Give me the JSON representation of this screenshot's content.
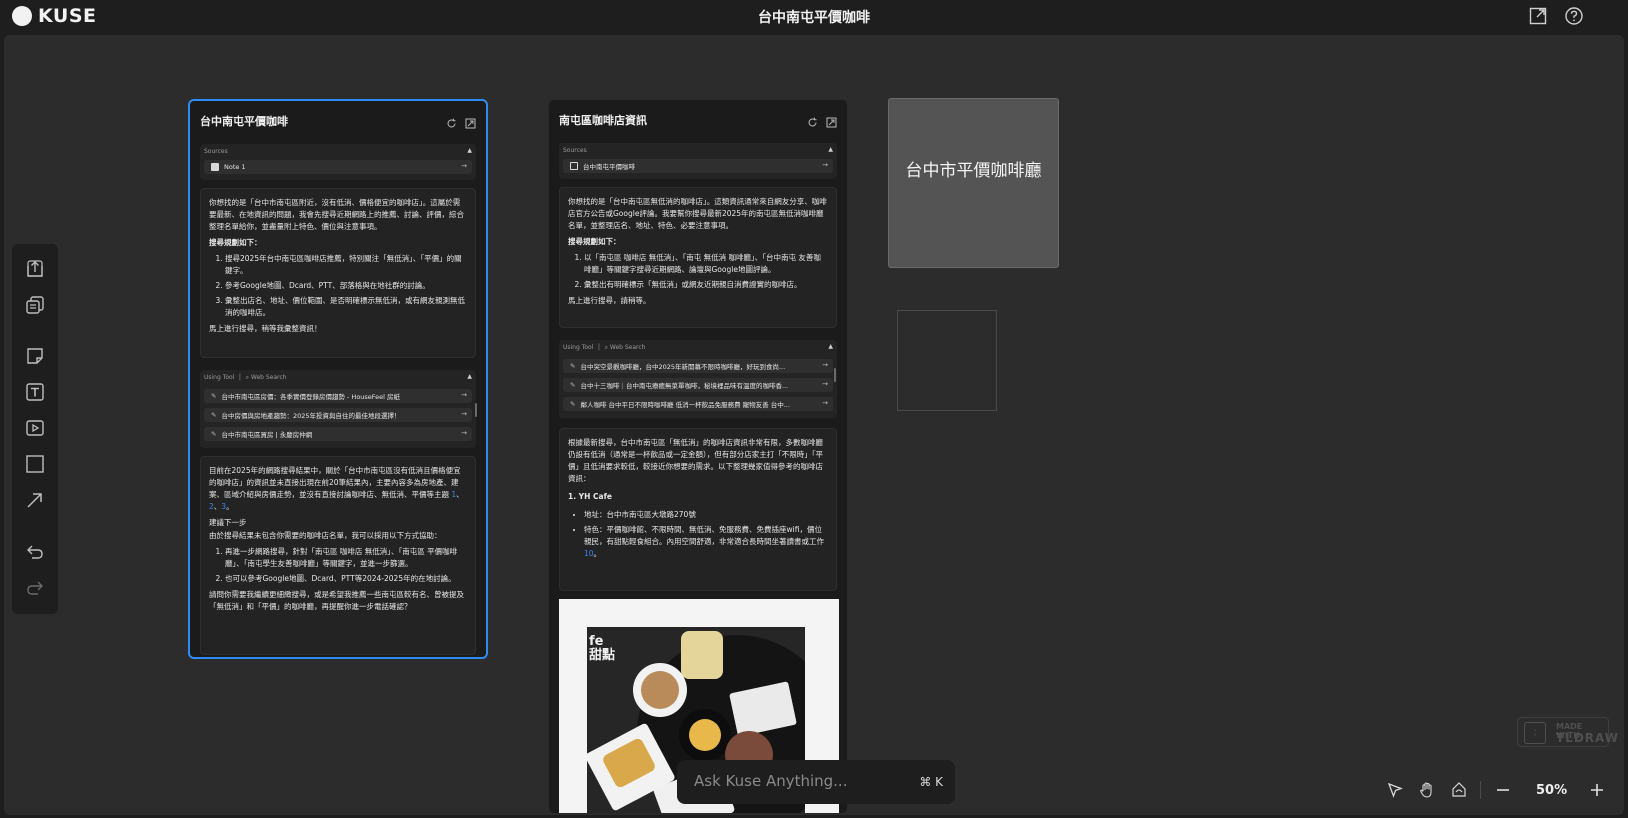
{
  "app": {
    "logo_text": "KUSE",
    "title": "台中南屯平價咖啡"
  },
  "topbar_icons": [
    "external-link-icon",
    "help-icon"
  ],
  "toolbar": {
    "tools": [
      "upload-icon",
      "copy-docs-icon",
      "note-icon",
      "text-icon",
      "video-icon",
      "frame-icon",
      "arrow-icon",
      "undo-icon",
      "redo-icon"
    ]
  },
  "card1": {
    "title": "台中南屯平價咖啡",
    "sources_label": "Sources",
    "source_item": "Note 1",
    "msg1": {
      "intro": "你想找的是「台中市南屯區附近，沒有低消、價格便宜的咖啡店」。這屬於需要最新、在地資訊的問題，我會先搜尋近期網路上的推薦、討論、評價，綜合整理名單給你，並盡量附上特色、價位與注意事項。",
      "plan_heading": "搜尋規劃如下：",
      "steps": [
        "搜尋2025年台中南屯區咖啡店推薦，特別關注「無低消」、「平價」的關鍵字。",
        "參考Google地圖、Dcard、PTT、部落格與在地社群的討論。",
        "彙整出店名、地址、價位範圍、是否明確標示無低消，或有網友親測無低消的咖啡店。"
      ],
      "closing": "馬上進行搜尋，稍等我彙整資訊！"
    },
    "using_tool_label": "Using Tool",
    "tool_name": "Web Search",
    "results": [
      "台中市南屯區房價：各季實價登錄房價趨勢 - HouseFeel 房紙",
      "台中房價與房地產趨勢：2025年投資與自住的最佳地段選擇！",
      "台中市南屯區買房 | 永慶房仲網"
    ],
    "msg2": {
      "para1": "目前在2025年的網路搜尋結果中，關於「台中市南屯區沒有低消且價格便宜的咖啡店」的資訊並未直接出現在前20筆結果內，主要內容多為房地產、建案、區域介紹與房價走勢，並沒有直接討論咖啡店、無低消、平價等主題",
      "cites": [
        "1",
        "2",
        "3"
      ],
      "next_heading": "建議下一步",
      "next_intro": "由於搜尋結果未包含你需要的咖啡店名單，我可以採用以下方式協助：",
      "next_steps": [
        "再進一步網路搜尋，針對「南屯區 咖啡店 無低消」、「南屯區 平價咖啡廳」、「南屯學生友善咖啡廳」等關鍵字，並進一步篩選。",
        "也可以參考Google地圖、Dcard、PTT等2024-2025年的在地討論。"
      ],
      "closing": "請問你需要我繼續更細緻搜尋，或是希望我推薦一些南屯區較有名、曾被提及「無低消」和「平價」的咖啡廳，再提醒你進一步電話確認？"
    }
  },
  "card2": {
    "title": "南屯區咖啡店資訊",
    "sources_label": "Sources",
    "source_item": "台中南屯平價咖啡",
    "msg1": {
      "intro": "你想找的是「台中南屯區無低消的咖啡店」。這類資訊通常來自網友分享、咖啡店官方公告或Google評論。我要幫你搜尋最新2025年的南屯區無低消咖啡廳名單，並整理店名、地址、特色、必要注意事項。",
      "plan_heading": "搜尋規劃如下：",
      "steps": [
        "以「南屯區 咖啡店 無低消」、「南屯 無低消 咖啡廳」、「台中南屯 友善咖啡廳」等關鍵字搜尋近期網路、論壇與Google地圖評論。",
        "彙整出有明確標示「無低消」或網友近期親自消費證實的咖啡店。"
      ],
      "closing": "馬上進行搜尋，請稍等。"
    },
    "using_tool_label": "Using Tool",
    "tool_name": "Web Search",
    "results": [
      "台中突空景觀咖啡廳，台中2025年新開幕不限時咖啡廳，好玩到食尚...",
      "台中十三咖啡｜台中南屯療癒無菜單咖啡，秘境裡品味有溫度的咖啡香...",
      "鄰人咖啡 台中平日不限時咖啡廳 低消一杯飲品免服務費 寵物友善 台中..."
    ],
    "msg2": {
      "para1": "根據最新搜尋，台中市南屯區「無低消」的咖啡店資訊非常有限，多數咖啡廳仍設有低消（通常是一杯飲品或一定金額），但有部分店家主打「不限時」「平價」且低消要求較低，較接近你想要的需求。以下整理幾家值得參考的咖啡店資訊：",
      "shop_heading": "1. YH Cafe",
      "bullets": [
        "地址：台中市南屯區大墩路270號",
        "特色：平價咖啡館、不限時間、無低消、免服務費、免費插座wifi，價位親民，有甜點輕食組合。內用空間舒適，非常適合長時間坐著讀書或工作"
      ],
      "cite": "10"
    },
    "photo_text_lines": [
      "fe",
      "甜點"
    ]
  },
  "note_card": {
    "text": "台中市平價咖啡廳"
  },
  "ask_bar": {
    "placeholder": "Ask Kuse Anything...",
    "shortcut": "⌘ K"
  },
  "watermark": {
    "line1": "MADE WITH",
    "line2": "TLDRAW"
  },
  "zoom": {
    "value": "50%"
  },
  "colors": {
    "accent": "#2e8cf0",
    "canvas": "#2c2c2c",
    "card": "#1b1b1b",
    "note": "#545454"
  }
}
